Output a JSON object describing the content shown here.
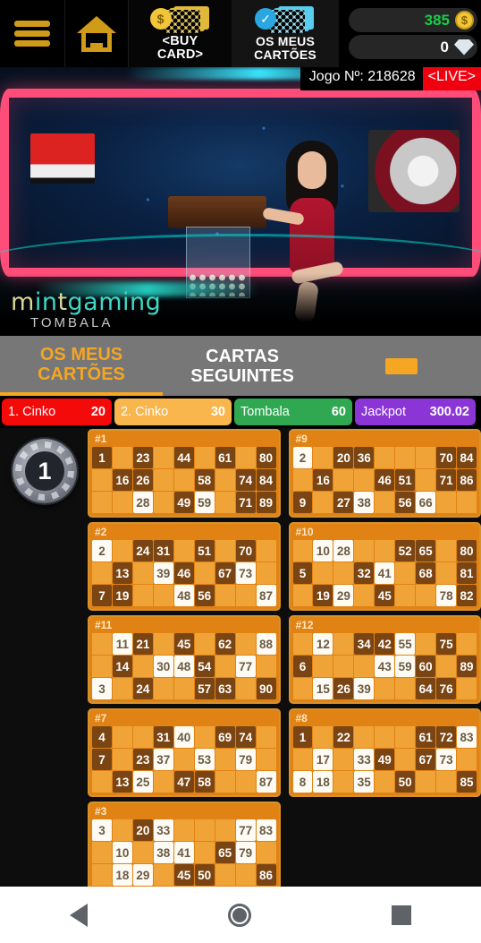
{
  "topbar": {
    "menu_icon": "hamburger-menu-icon",
    "home_icon": "home-icon",
    "buy_card_label": "<BUY\nCARD>",
    "buy_card_line1": "<BUY",
    "buy_card_line2": "CARD>",
    "my_cards_line1": "OS MEUS",
    "my_cards_line2": "CARTÕES",
    "coin_balance": "385",
    "gem_balance": "0",
    "coin_icon": "coin-icon",
    "gem_icon": "diamond-icon",
    "coin_color": "#19cc4a"
  },
  "video": {
    "game_label": "Jogo Nº: 218628",
    "live_label": "<LIVE>",
    "live_color": "#f0000f",
    "brand_m": "m",
    "brand_i": "i",
    "brand_n": "n",
    "brand_t": "t",
    "brand_gaming": "gaming",
    "brand_line1": "mintgaming",
    "brand_line2": "TOMBALA"
  },
  "tabs": {
    "tab1_line1": "OS MEUS",
    "tab1_line2": "CARTÕES",
    "tab2_line1": "CARTAS",
    "tab2_line2": "SEGUINTES",
    "active_color": "#f5a623"
  },
  "prizes": [
    {
      "name": "1. Cinko",
      "value": "20",
      "color": "#f50a0a"
    },
    {
      "name": "2. Cinko",
      "value": "30",
      "color": "#f9b64c"
    },
    {
      "name": "Tombala",
      "value": "60",
      "color": "#30a852"
    },
    {
      "name": "Jackpot",
      "value": "300.02",
      "color": "#8b35d6"
    }
  ],
  "board": {
    "last_ball": "1"
  },
  "cards": [
    {
      "id": "#1",
      "rows": [
        [
          {
            "v": "1",
            "s": "num"
          },
          {
            "v": "",
            "s": "empty"
          },
          {
            "v": "23",
            "s": "num"
          },
          {
            "v": "",
            "s": "empty"
          },
          {
            "v": "44",
            "s": "num"
          },
          {
            "v": "",
            "s": "empty"
          },
          {
            "v": "61",
            "s": "num"
          },
          {
            "v": "",
            "s": "empty"
          },
          {
            "v": "80",
            "s": "num"
          }
        ],
        [
          {
            "v": "",
            "s": "empty"
          },
          {
            "v": "16",
            "s": "num"
          },
          {
            "v": "26",
            "s": "num"
          },
          {
            "v": "",
            "s": "empty"
          },
          {
            "v": "",
            "s": "empty"
          },
          {
            "v": "58",
            "s": "num"
          },
          {
            "v": "",
            "s": "empty"
          },
          {
            "v": "74",
            "s": "num"
          },
          {
            "v": "84",
            "s": "num"
          }
        ],
        [
          {
            "v": "",
            "s": "empty"
          },
          {
            "v": "",
            "s": "empty"
          },
          {
            "v": "28",
            "s": "mark"
          },
          {
            "v": "",
            "s": "empty"
          },
          {
            "v": "49",
            "s": "num"
          },
          {
            "v": "59",
            "s": "mark"
          },
          {
            "v": "",
            "s": "empty"
          },
          {
            "v": "71",
            "s": "num"
          },
          {
            "v": "89",
            "s": "num"
          }
        ]
      ]
    },
    {
      "id": "#9",
      "rows": [
        [
          {
            "v": "2",
            "s": "mark"
          },
          {
            "v": "",
            "s": "empty"
          },
          {
            "v": "20",
            "s": "num"
          },
          {
            "v": "36",
            "s": "num"
          },
          {
            "v": "",
            "s": "empty"
          },
          {
            "v": "",
            "s": "empty"
          },
          {
            "v": "",
            "s": "empty"
          },
          {
            "v": "70",
            "s": "num"
          },
          {
            "v": "84",
            "s": "num"
          }
        ],
        [
          {
            "v": "",
            "s": "empty"
          },
          {
            "v": "16",
            "s": "num"
          },
          {
            "v": "",
            "s": "empty"
          },
          {
            "v": "",
            "s": "empty"
          },
          {
            "v": "46",
            "s": "num"
          },
          {
            "v": "51",
            "s": "num"
          },
          {
            "v": "",
            "s": "empty"
          },
          {
            "v": "71",
            "s": "num"
          },
          {
            "v": "86",
            "s": "num"
          }
        ],
        [
          {
            "v": "9",
            "s": "num"
          },
          {
            "v": "",
            "s": "empty"
          },
          {
            "v": "27",
            "s": "num"
          },
          {
            "v": "38",
            "s": "mark"
          },
          {
            "v": "",
            "s": "empty"
          },
          {
            "v": "56",
            "s": "num"
          },
          {
            "v": "66",
            "s": "mark"
          },
          {
            "v": "",
            "s": "empty"
          },
          {
            "v": "",
            "s": "empty"
          }
        ]
      ]
    },
    {
      "id": "#2",
      "rows": [
        [
          {
            "v": "2",
            "s": "mark"
          },
          {
            "v": "",
            "s": "empty"
          },
          {
            "v": "24",
            "s": "num"
          },
          {
            "v": "31",
            "s": "num"
          },
          {
            "v": "",
            "s": "empty"
          },
          {
            "v": "51",
            "s": "num"
          },
          {
            "v": "",
            "s": "empty"
          },
          {
            "v": "70",
            "s": "num"
          },
          {
            "v": "",
            "s": "empty"
          }
        ],
        [
          {
            "v": "",
            "s": "empty"
          },
          {
            "v": "13",
            "s": "num"
          },
          {
            "v": "",
            "s": "empty"
          },
          {
            "v": "39",
            "s": "mark"
          },
          {
            "v": "46",
            "s": "num"
          },
          {
            "v": "",
            "s": "empty"
          },
          {
            "v": "67",
            "s": "num"
          },
          {
            "v": "73",
            "s": "mark"
          },
          {
            "v": "",
            "s": "empty"
          }
        ],
        [
          {
            "v": "7",
            "s": "num"
          },
          {
            "v": "19",
            "s": "num"
          },
          {
            "v": "",
            "s": "empty"
          },
          {
            "v": "",
            "s": "empty"
          },
          {
            "v": "48",
            "s": "mark"
          },
          {
            "v": "56",
            "s": "num"
          },
          {
            "v": "",
            "s": "empty"
          },
          {
            "v": "",
            "s": "empty"
          },
          {
            "v": "87",
            "s": "mark"
          }
        ]
      ]
    },
    {
      "id": "#10",
      "rows": [
        [
          {
            "v": "",
            "s": "empty"
          },
          {
            "v": "10",
            "s": "mark"
          },
          {
            "v": "28",
            "s": "mark"
          },
          {
            "v": "",
            "s": "empty"
          },
          {
            "v": "",
            "s": "empty"
          },
          {
            "v": "52",
            "s": "num"
          },
          {
            "v": "65",
            "s": "num"
          },
          {
            "v": "",
            "s": "empty"
          },
          {
            "v": "80",
            "s": "num"
          }
        ],
        [
          {
            "v": "5",
            "s": "num"
          },
          {
            "v": "",
            "s": "empty"
          },
          {
            "v": "",
            "s": "empty"
          },
          {
            "v": "32",
            "s": "num"
          },
          {
            "v": "41",
            "s": "mark"
          },
          {
            "v": "",
            "s": "empty"
          },
          {
            "v": "68",
            "s": "num"
          },
          {
            "v": "",
            "s": "empty"
          },
          {
            "v": "81",
            "s": "num"
          }
        ],
        [
          {
            "v": "",
            "s": "empty"
          },
          {
            "v": "19",
            "s": "num"
          },
          {
            "v": "29",
            "s": "mark"
          },
          {
            "v": "",
            "s": "empty"
          },
          {
            "v": "45",
            "s": "num"
          },
          {
            "v": "",
            "s": "empty"
          },
          {
            "v": "",
            "s": "empty"
          },
          {
            "v": "78",
            "s": "mark"
          },
          {
            "v": "82",
            "s": "num"
          }
        ]
      ]
    },
    {
      "id": "#11",
      "rows": [
        [
          {
            "v": "",
            "s": "empty"
          },
          {
            "v": "11",
            "s": "mark"
          },
          {
            "v": "21",
            "s": "num"
          },
          {
            "v": "",
            "s": "empty"
          },
          {
            "v": "45",
            "s": "num"
          },
          {
            "v": "",
            "s": "empty"
          },
          {
            "v": "62",
            "s": "num"
          },
          {
            "v": "",
            "s": "empty"
          },
          {
            "v": "88",
            "s": "mark"
          }
        ],
        [
          {
            "v": "",
            "s": "empty"
          },
          {
            "v": "14",
            "s": "num"
          },
          {
            "v": "",
            "s": "empty"
          },
          {
            "v": "30",
            "s": "mark"
          },
          {
            "v": "48",
            "s": "mark"
          },
          {
            "v": "54",
            "s": "num"
          },
          {
            "v": "",
            "s": "empty"
          },
          {
            "v": "77",
            "s": "mark"
          },
          {
            "v": "",
            "s": "empty"
          }
        ],
        [
          {
            "v": "3",
            "s": "mark"
          },
          {
            "v": "",
            "s": "empty"
          },
          {
            "v": "24",
            "s": "num"
          },
          {
            "v": "",
            "s": "empty"
          },
          {
            "v": "",
            "s": "empty"
          },
          {
            "v": "57",
            "s": "num"
          },
          {
            "v": "63",
            "s": "num"
          },
          {
            "v": "",
            "s": "empty"
          },
          {
            "v": "90",
            "s": "num"
          }
        ]
      ]
    },
    {
      "id": "#12",
      "rows": [
        [
          {
            "v": "",
            "s": "empty"
          },
          {
            "v": "12",
            "s": "mark"
          },
          {
            "v": "",
            "s": "empty"
          },
          {
            "v": "34",
            "s": "num"
          },
          {
            "v": "42",
            "s": "num"
          },
          {
            "v": "55",
            "s": "mark"
          },
          {
            "v": "",
            "s": "empty"
          },
          {
            "v": "75",
            "s": "num"
          },
          {
            "v": "",
            "s": "empty"
          }
        ],
        [
          {
            "v": "6",
            "s": "num"
          },
          {
            "v": "",
            "s": "empty"
          },
          {
            "v": "",
            "s": "empty"
          },
          {
            "v": "",
            "s": "empty"
          },
          {
            "v": "43",
            "s": "mark"
          },
          {
            "v": "59",
            "s": "mark"
          },
          {
            "v": "60",
            "s": "num"
          },
          {
            "v": "",
            "s": "empty"
          },
          {
            "v": "89",
            "s": "num"
          }
        ],
        [
          {
            "v": "",
            "s": "empty"
          },
          {
            "v": "15",
            "s": "mark"
          },
          {
            "v": "26",
            "s": "num"
          },
          {
            "v": "39",
            "s": "mark"
          },
          {
            "v": "",
            "s": "empty"
          },
          {
            "v": "",
            "s": "empty"
          },
          {
            "v": "64",
            "s": "num"
          },
          {
            "v": "76",
            "s": "num"
          },
          {
            "v": "",
            "s": "empty"
          }
        ]
      ]
    },
    {
      "id": "#7",
      "rows": [
        [
          {
            "v": "4",
            "s": "num"
          },
          {
            "v": "",
            "s": "empty"
          },
          {
            "v": "",
            "s": "empty"
          },
          {
            "v": "31",
            "s": "num"
          },
          {
            "v": "40",
            "s": "mark"
          },
          {
            "v": "",
            "s": "empty"
          },
          {
            "v": "69",
            "s": "num"
          },
          {
            "v": "74",
            "s": "num"
          },
          {
            "v": "",
            "s": "empty"
          }
        ],
        [
          {
            "v": "7",
            "s": "num"
          },
          {
            "v": "",
            "s": "empty"
          },
          {
            "v": "23",
            "s": "num"
          },
          {
            "v": "37",
            "s": "mark"
          },
          {
            "v": "",
            "s": "empty"
          },
          {
            "v": "53",
            "s": "mark"
          },
          {
            "v": "",
            "s": "empty"
          },
          {
            "v": "79",
            "s": "mark"
          },
          {
            "v": "",
            "s": "empty"
          }
        ],
        [
          {
            "v": "",
            "s": "empty"
          },
          {
            "v": "13",
            "s": "num"
          },
          {
            "v": "25",
            "s": "mark"
          },
          {
            "v": "",
            "s": "empty"
          },
          {
            "v": "47",
            "s": "num"
          },
          {
            "v": "58",
            "s": "num"
          },
          {
            "v": "",
            "s": "empty"
          },
          {
            "v": "",
            "s": "empty"
          },
          {
            "v": "87",
            "s": "mark"
          }
        ]
      ]
    },
    {
      "id": "#8",
      "rows": [
        [
          {
            "v": "1",
            "s": "num"
          },
          {
            "v": "",
            "s": "empty"
          },
          {
            "v": "22",
            "s": "num"
          },
          {
            "v": "",
            "s": "empty"
          },
          {
            "v": "",
            "s": "empty"
          },
          {
            "v": "",
            "s": "empty"
          },
          {
            "v": "61",
            "s": "num"
          },
          {
            "v": "72",
            "s": "num"
          },
          {
            "v": "83",
            "s": "mark"
          }
        ],
        [
          {
            "v": "",
            "s": "empty"
          },
          {
            "v": "17",
            "s": "mark"
          },
          {
            "v": "",
            "s": "empty"
          },
          {
            "v": "33",
            "s": "mark"
          },
          {
            "v": "49",
            "s": "num"
          },
          {
            "v": "",
            "s": "empty"
          },
          {
            "v": "67",
            "s": "num"
          },
          {
            "v": "73",
            "s": "mark"
          },
          {
            "v": "",
            "s": "empty"
          }
        ],
        [
          {
            "v": "8",
            "s": "mark"
          },
          {
            "v": "18",
            "s": "mark"
          },
          {
            "v": "",
            "s": "empty"
          },
          {
            "v": "35",
            "s": "mark"
          },
          {
            "v": "",
            "s": "empty"
          },
          {
            "v": "50",
            "s": "num"
          },
          {
            "v": "",
            "s": "empty"
          },
          {
            "v": "",
            "s": "empty"
          },
          {
            "v": "85",
            "s": "num"
          }
        ]
      ]
    },
    {
      "id": "#3",
      "rows": [
        [
          {
            "v": "3",
            "s": "mark"
          },
          {
            "v": "",
            "s": "empty"
          },
          {
            "v": "20",
            "s": "num"
          },
          {
            "v": "33",
            "s": "mark"
          },
          {
            "v": "",
            "s": "empty"
          },
          {
            "v": "",
            "s": "empty"
          },
          {
            "v": "",
            "s": "empty"
          },
          {
            "v": "77",
            "s": "mark"
          },
          {
            "v": "83",
            "s": "mark"
          }
        ],
        [
          {
            "v": "",
            "s": "empty"
          },
          {
            "v": "10",
            "s": "mark"
          },
          {
            "v": "",
            "s": "empty"
          },
          {
            "v": "38",
            "s": "mark"
          },
          {
            "v": "41",
            "s": "mark"
          },
          {
            "v": "",
            "s": "empty"
          },
          {
            "v": "65",
            "s": "num"
          },
          {
            "v": "79",
            "s": "mark"
          },
          {
            "v": "",
            "s": "empty"
          }
        ],
        [
          {
            "v": "",
            "s": "empty"
          },
          {
            "v": "18",
            "s": "mark"
          },
          {
            "v": "29",
            "s": "mark"
          },
          {
            "v": "",
            "s": "empty"
          },
          {
            "v": "45",
            "s": "num"
          },
          {
            "v": "50",
            "s": "num"
          },
          {
            "v": "",
            "s": "empty"
          },
          {
            "v": "",
            "s": "empty"
          },
          {
            "v": "86",
            "s": "num"
          }
        ]
      ]
    }
  ],
  "navbar": {
    "back_icon": "back-triangle-icon",
    "home_icon": "home-circle-icon",
    "recents_icon": "recents-square-icon"
  }
}
